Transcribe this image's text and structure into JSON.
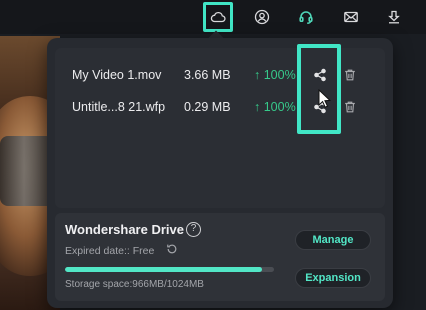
{
  "toolbar": {
    "icons": [
      "cloud-icon",
      "account-icon",
      "headset-icon",
      "mail-icon",
      "download-icon"
    ]
  },
  "files": [
    {
      "name": "My Video 1.mov",
      "size": "3.66 MB",
      "progress": "↑ 100%"
    },
    {
      "name": "Untitle...8 21.wfp",
      "size": "0.29 MB",
      "progress": "↑ 100%"
    }
  ],
  "drive": {
    "title": "Wondershare Drive",
    "help": "?",
    "expired": "Expired date:: Free",
    "storage": "Storage space:966MB/1024MB",
    "storage_fraction": 0.943,
    "manage_label": "Manage",
    "expansion_label": "Expansion"
  },
  "colors": {
    "accent": "#52e6c6",
    "highlight": "#41e6c6",
    "progress_text": "#36c98a"
  }
}
